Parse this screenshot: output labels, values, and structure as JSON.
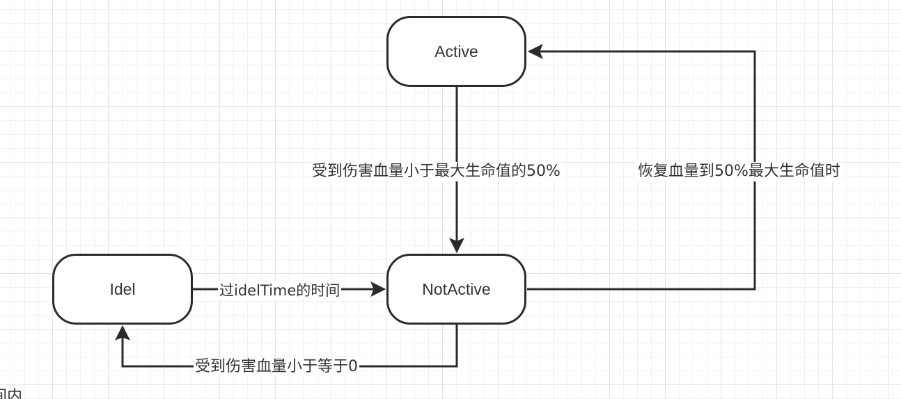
{
  "nodes": {
    "active": "Active",
    "not_active": "NotActive",
    "idel": "Idel"
  },
  "edges": {
    "active_to_notactive": "受到伤害血量小于最大生命值的50%",
    "notactive_to_active": "恢复血量到50%最大生命值时",
    "idel_to_notactive": "过idelTime的时间",
    "notactive_to_idel": "受到伤害血量小于等于0"
  },
  "partial_text": "间内",
  "colors": {
    "stroke": "#2b2b2b",
    "text": "#333333",
    "grid": "#e3e3e3"
  }
}
